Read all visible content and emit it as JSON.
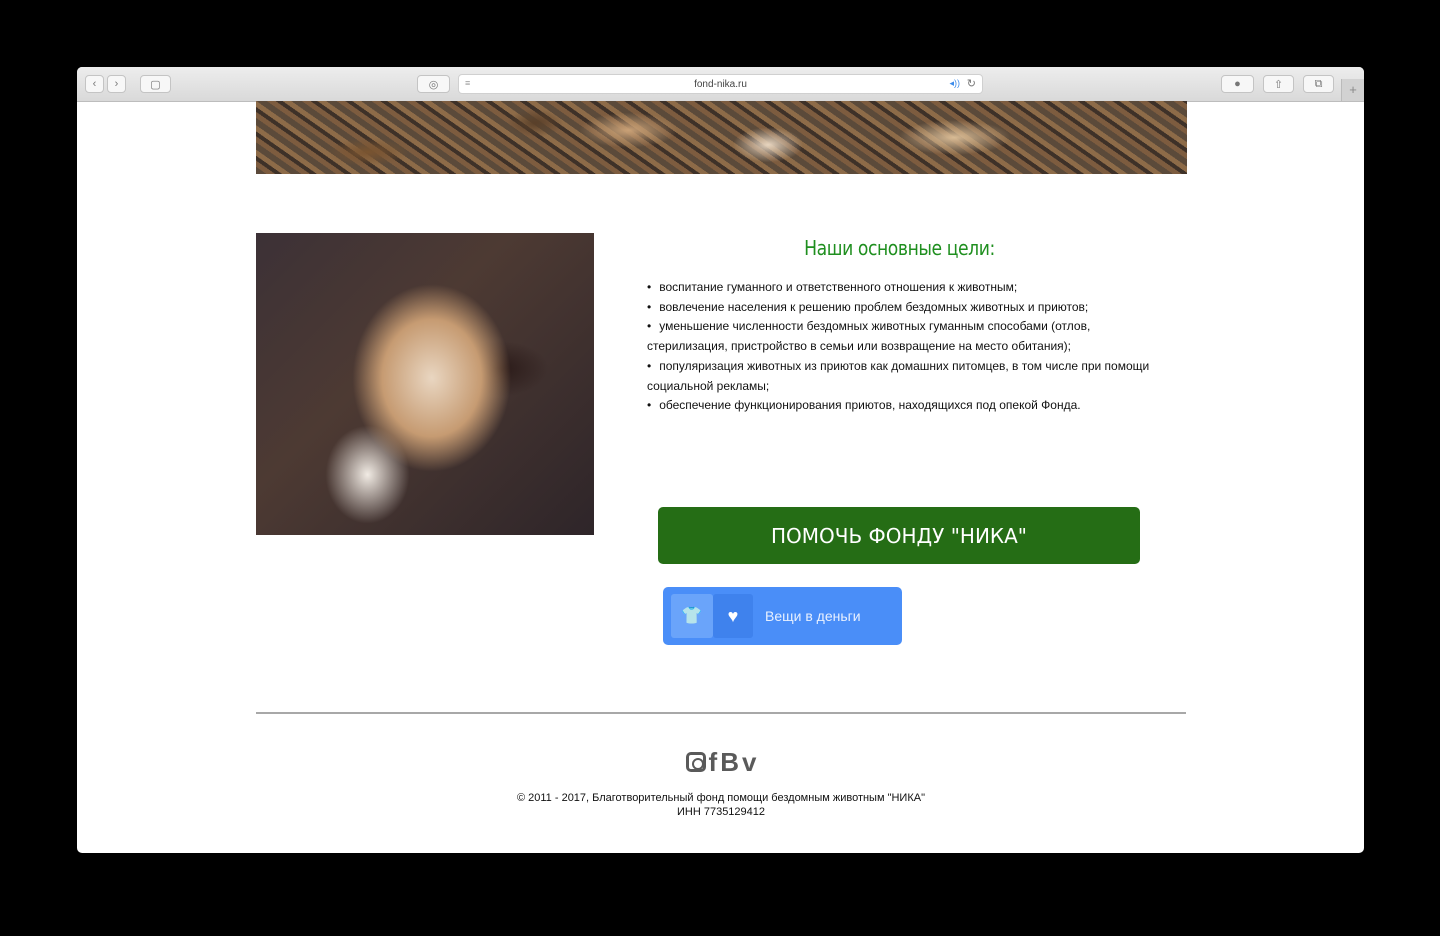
{
  "browser": {
    "url": "fond-nika.ru",
    "nav_back_glyph": "‹",
    "nav_forward_glyph": "›",
    "sidebar_glyph": "▢",
    "privacy_glyph": "◎",
    "reader_glyph": "≡",
    "audio_glyph": "◂))",
    "reload_glyph": "↻",
    "info_glyph": "●",
    "share_glyph": "⇧",
    "tabs_glyph": "⧉",
    "new_tab_glyph": "+"
  },
  "goals": {
    "title": "Наши основные цели:",
    "items": [
      "воспитание гуманного и ответственного отношения к животным;",
      "вовлечение населения к решению проблем бездомных животных и приютов;",
      "уменьшение численности бездомных животных гуманным способами (отлов, стерилизация, пристройство в семьи или возвращение на место обитания);",
      "популяризация животных из приютов как домашних питомцев, в том числе при помощи социальной рекламы;",
      "обеспечение функционирования приютов, находящихся под опекой Фонда."
    ]
  },
  "buttons": {
    "help": "ПОМОЧЬ ФОНДУ \"НИКА\"",
    "things_to_money": "Вещи в деньги",
    "shirt_glyph": "👕",
    "heart_glyph": "♥"
  },
  "social": {
    "facebook": "f",
    "vk": "B",
    "vimeo": "v"
  },
  "footer": {
    "copyright": "© 2011 - 2017, Благотворительный фонд помощи бездомным животным \"НИКА\"",
    "inn": "ИНН 7735129412"
  }
}
